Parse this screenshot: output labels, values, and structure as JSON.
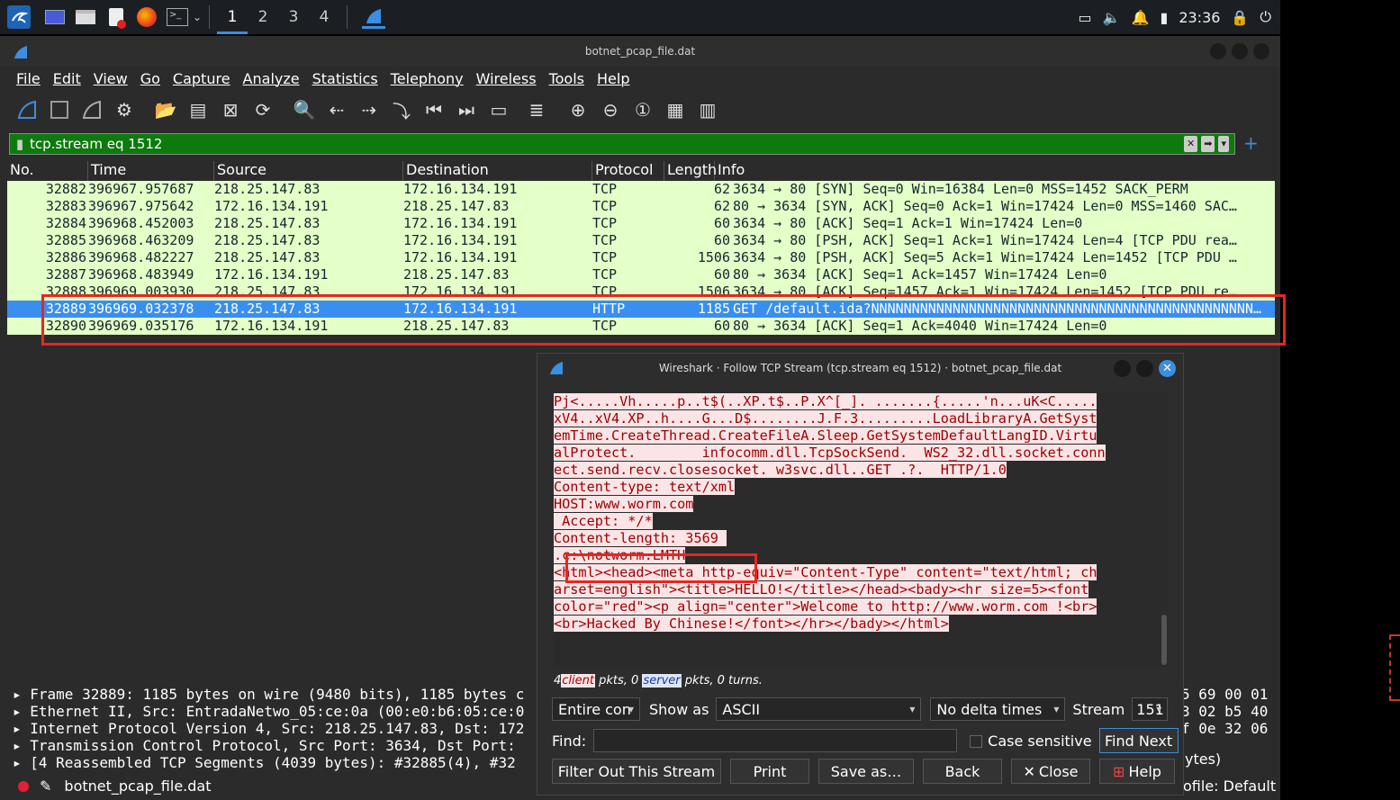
{
  "taskbar": {
    "workspaces": [
      "1",
      "2",
      "3",
      "4"
    ],
    "clock": "23:36"
  },
  "window": {
    "title": "botnet_pcap_file.dat"
  },
  "menu": [
    "File",
    "Edit",
    "View",
    "Go",
    "Capture",
    "Analyze",
    "Statistics",
    "Telephony",
    "Wireless",
    "Tools",
    "Help"
  ],
  "filter": {
    "value": "tcp.stream eq 1512"
  },
  "packet_list": {
    "columns": [
      "No.",
      "Time",
      "Source",
      "Destination",
      "Protocol",
      "Length",
      "Info"
    ],
    "rows": [
      {
        "no": "32882",
        "time": "396967.957687",
        "src": "218.25.147.83",
        "dst": "172.16.134.191",
        "proto": "TCP",
        "len": "62",
        "info": "3634 → 80 [SYN] Seq=0 Win=16384 Len=0 MSS=1452 SACK_PERM"
      },
      {
        "no": "32883",
        "time": "396967.975642",
        "src": "172.16.134.191",
        "dst": "218.25.147.83",
        "proto": "TCP",
        "len": "62",
        "info": "80 → 3634 [SYN, ACK] Seq=0 Ack=1 Win=17424 Len=0 MSS=1460 SAC…"
      },
      {
        "no": "32884",
        "time": "396968.452003",
        "src": "218.25.147.83",
        "dst": "172.16.134.191",
        "proto": "TCP",
        "len": "60",
        "info": "3634 → 80 [ACK] Seq=1 Ack=1 Win=17424 Len=0"
      },
      {
        "no": "32885",
        "time": "396968.463209",
        "src": "218.25.147.83",
        "dst": "172.16.134.191",
        "proto": "TCP",
        "len": "60",
        "info": "3634 → 80 [PSH, ACK] Seq=1 Ack=1 Win=17424 Len=4 [TCP PDU rea…"
      },
      {
        "no": "32886",
        "time": "396968.482227",
        "src": "218.25.147.83",
        "dst": "172.16.134.191",
        "proto": "TCP",
        "len": "1506",
        "info": "3634 → 80 [PSH, ACK] Seq=5 Ack=1 Win=17424 Len=1452 [TCP PDU …"
      },
      {
        "no": "32887",
        "time": "396968.483949",
        "src": "172.16.134.191",
        "dst": "218.25.147.83",
        "proto": "TCP",
        "len": "60",
        "info": "80 → 3634 [ACK] Seq=1 Ack=1457 Win=17424 Len=0"
      },
      {
        "no": "32888",
        "time": "396969.003930",
        "src": "218.25.147.83",
        "dst": "172.16.134.191",
        "proto": "TCP",
        "len": "1506",
        "info": "3634 → 80 [ACK] Seq=1457 Ack=1 Win=17424 Len=1452 [TCP PDU re…"
      },
      {
        "no": "32889",
        "time": "396969.032378",
        "src": "218.25.147.83",
        "dst": "172.16.134.191",
        "proto": "HTTP",
        "len": "1185",
        "info": "GET /default.ida?NNNNNNNNNNNNNNNNNNNNNNNNNNNNNNNNNNNNNNNNNNNNNNN…"
      },
      {
        "no": "32890",
        "time": "396969.035176",
        "src": "172.16.134.191",
        "dst": "218.25.147.83",
        "proto": "TCP",
        "len": "60",
        "info": "80 → 3634 [ACK] Seq=1 Ack=4040 Win=17424 Len=0"
      }
    ]
  },
  "details": [
    "Frame 32889: 1185 bytes on wire (9480 bits), 1185 bytes c",
    "Ethernet II, Src: EntradaNetwo_05:ce:0a (00:e0:b6:05:ce:0",
    "Internet Protocol Version 4, Src: 218.25.147.83, Dst: 172",
    "Transmission Control Protocol, Src Port: 3634, Dst Port: ",
    "[4 Reassembled TCP Segments (4039 bytes): #32885(4), #32"
  ],
  "hex": [
    "5 69 00 01",
    "3 02 b5 40",
    "f 0e 32 06"
  ],
  "statusbar": {
    "file": "botnet_pcap_file.dat",
    "profile": "ofile: Default",
    "bytes_frag": "ytes)"
  },
  "dialog": {
    "title": "Wireshark · Follow TCP Stream (tcp.stream eq 1512) · botnet_pcap_file.dat",
    "stream_lines": [
      "Pj<.....Vh.....p..t$(..XP.t$..P.X^[_]. .......{.....'n...uK<C.....",
      "xV4..xV4.XP..h....G...D$........J.F.3.........LoadLibraryA.GetSyst",
      "emTime.CreateThread.CreateFileA.Sleep.GetSystemDefaultLangID.Virtu",
      "alProtect.        infocomm.dll.TcpSockSend.  WS2_32.dll.socket.conn",
      "ect.send.recv.closesocket. w3svc.dll..GET .?.  HTTP/1.0",
      "Content-type: text/xml",
      "HOST:www.worm.com",
      " Accept: */*",
      "Content-length: 3569 ",
      "",
      ".c:\\notworm.LMTH",
      "<html><head><meta http-equiv=\"Content-Type\" content=\"text/html; ch",
      "arset=english\"><title>HELLO!</title></head><bady><hr size=5><font",
      "color=\"red\"><p align=\"center\">Welcome to http://www.worm.com !<br>",
      "<br>Hacked By Chinese!</font></hr></bady></html>"
    ],
    "turns": {
      "client_count": "4",
      "client": "client",
      "mid": " pkts, 0 ",
      "server": "server",
      "tail": " pkts, 0 turns."
    },
    "conversation": "Entire con",
    "show_as_label": "Show as",
    "show_as": "ASCII",
    "delta": "No delta times",
    "stream_label": "Stream",
    "stream_no": "151",
    "find_label": "Find:",
    "case_label": "Case sensitive",
    "find_next": "Find Next",
    "buttons": {
      "filter_out": "Filter Out This Stream",
      "print": "Print",
      "save_as": "Save as…",
      "back": "Back",
      "close": "Close",
      "help": "Help"
    }
  },
  "colors": {
    "tcp_row": "#e4ffc7",
    "selected": "#3a8ef0",
    "filter_bg": "#0e7a0e",
    "highlight_red": "#e8261f"
  }
}
